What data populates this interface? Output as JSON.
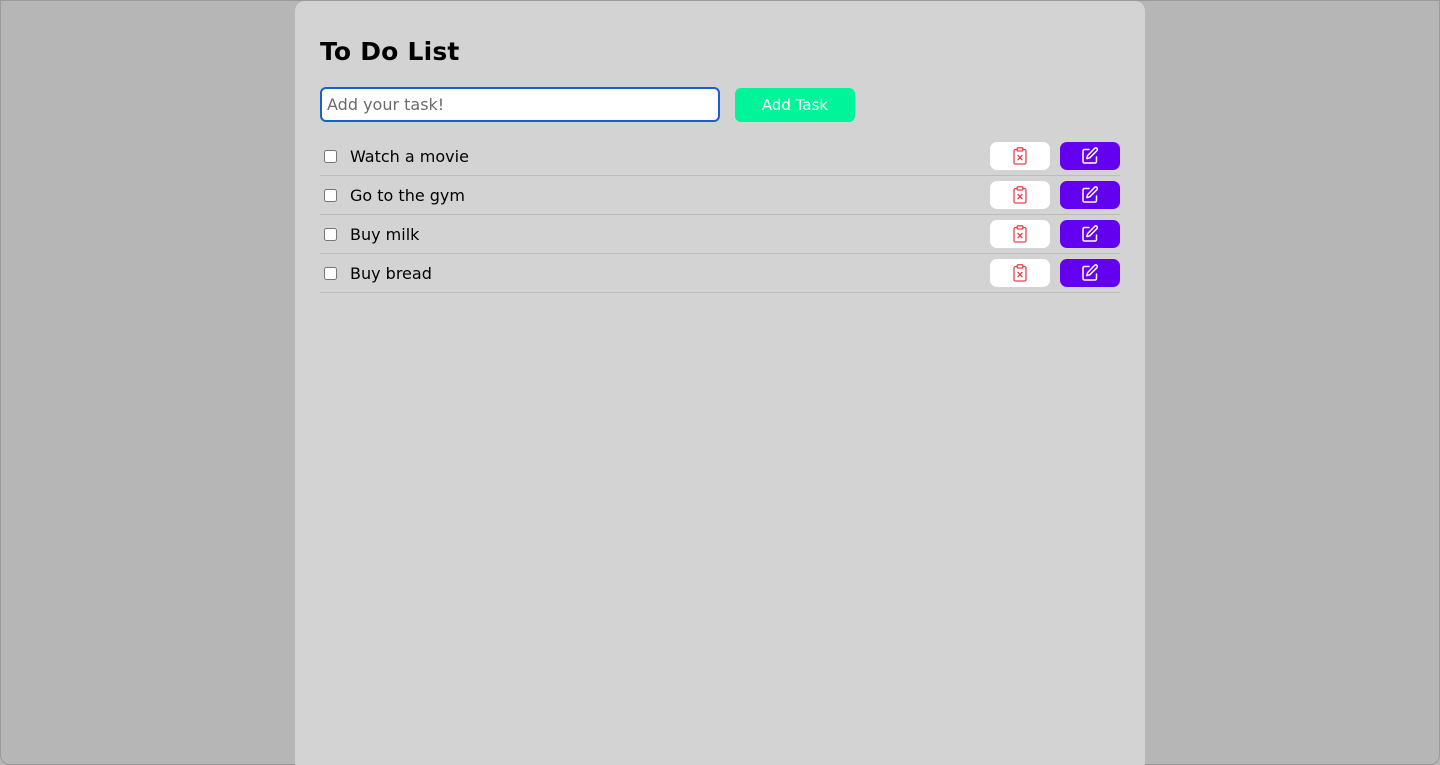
{
  "app": {
    "title": "To Do List"
  },
  "add_form": {
    "input_placeholder": "Add your task!",
    "input_value": "",
    "add_button_label": "Add Task"
  },
  "tasks": [
    {
      "text": "Watch a movie",
      "done": false
    },
    {
      "text": "Go to the gym",
      "done": false
    },
    {
      "text": "Buy milk",
      "done": false
    },
    {
      "text": "Buy bread",
      "done": false
    }
  ],
  "icons": {
    "delete": "clipboard-x-icon",
    "edit": "edit-pencil-icon"
  },
  "colors": {
    "page_background": "#b6b6b6",
    "card_background": "#d3d3d3",
    "add_button": "#00f49a",
    "edit_button": "#6300f0",
    "delete_button": "#ffffff",
    "delete_icon": "#e8434f",
    "input_focus_border": "#1a5fd0"
  }
}
